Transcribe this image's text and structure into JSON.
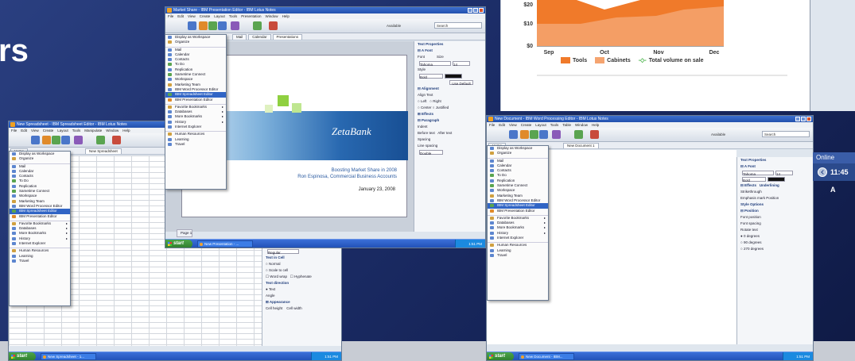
{
  "slide": {
    "title_fragment": "rs"
  },
  "chart": {
    "y_ticks": [
      "$20",
      "$10",
      "$0"
    ],
    "x_ticks": [
      "Sep",
      "Oct",
      "Nov",
      "Dec"
    ],
    "legend": [
      "Tools",
      "Cabinets",
      "Total volume on sale"
    ],
    "colors": {
      "tools": "#f08030",
      "cabinets": "#f6a878",
      "total": "#33aa33"
    }
  },
  "presentation_window": {
    "title": "Market Share - IBM Presentation Editor - IBM Lotus Notes",
    "menu": [
      "File",
      "Edit",
      "View",
      "Create",
      "Layout",
      "Tools",
      "Presentation",
      "Window",
      "Help"
    ],
    "available": "Available",
    "search": "Search",
    "tabs": [
      "Home",
      "Mail",
      "Calendar",
      "Presentations"
    ],
    "slide_brand": "ZetaBank",
    "slide_heading": "Boosting Market Share in 2008",
    "slide_sub": "Ron Espinosa, Commercial Business Accounts",
    "slide_date": "January 23, 2008",
    "panel": {
      "title": "Text Properties",
      "font": "Font",
      "font_label": "Font",
      "size_label": "Size",
      "font_value": "Tahoma",
      "size_value": "14",
      "style_label": "Style",
      "style_value": "Bold",
      "font_color": "Font color",
      "use_default": "Use Default",
      "alignment": "Alignment",
      "align_text": "Align Text",
      "left": "Left",
      "right": "Right",
      "center": "Center",
      "justified": "Justified",
      "effects": "Effects",
      "paragraph": "Paragraph",
      "indent": "Indent",
      "before_text": "Before text",
      "after_text": "After text",
      "spacing": "Spacing",
      "line_spacing": "Line spacing",
      "line_spacing_value": "Double"
    },
    "page_label": "Page 1",
    "taskbar_start": "start",
    "taskbar_item": "New Presentation - ...",
    "clock": "1:51 PM"
  },
  "spreadsheet_window": {
    "title": "New Spreadsheet - IBM Spreadsheet Editor - IBM Lotus Notes",
    "menu": [
      "File",
      "Edit",
      "View",
      "Create",
      "Layout",
      "Tools",
      "Manipulate",
      "Window",
      "Help"
    ],
    "tabs": [
      "Home",
      "New Spreadsheet"
    ],
    "panel": {
      "regular": "Regular",
      "text_in_cell": "Text in Cell",
      "normal": "Normal",
      "scale_to_cell": "Scale to cell",
      "word_wrap": "Word wrap",
      "hyphenate": "Hyphenate",
      "text_direction": "Text direction",
      "text": "Text",
      "angle": "Angle",
      "appearance": "Appearance",
      "cell_height": "Cell height",
      "cell_width": "Cell width"
    },
    "taskbar_start": "start",
    "taskbar_item": "New Spreadsheet - 1...",
    "clock": "1:51 PM",
    "status": "Online"
  },
  "document_window": {
    "title": "New Document - IBM Word Processing Editor - IBM Lotus Notes",
    "menu": [
      "File",
      "Edit",
      "View",
      "Create",
      "Layout",
      "Tools",
      "Table",
      "Window",
      "Help"
    ],
    "available": "Available",
    "search": "Search",
    "tabs": [
      "Home",
      "New Document 1"
    ],
    "panel": {
      "title": "Text Properties",
      "font": "Font",
      "font_value": "Tahoma",
      "size_value": "14",
      "style_value": "Bold",
      "effects": "Effects",
      "underlining": "Underlining",
      "strikethrough": "Strikethrough",
      "emphasis": "Emphasis mark",
      "position": "Position",
      "style_options": "Style Options",
      "position_head": "Position",
      "font_position": "Font position",
      "font_spacing": "Font spacing",
      "rotate_text": "Rotate text",
      "deg0": "0 degrees",
      "deg90": "90 degrees",
      "deg270": "270 degrees"
    },
    "taskbar_start": "start",
    "taskbar_item": "New Document - IBM...",
    "clock": "1:51 PM",
    "status": "Online"
  },
  "launcher_menu": {
    "items": [
      "Display as Workspace",
      "Organize",
      "",
      "Mail",
      "Calendar",
      "Contacts",
      "To Do",
      "Replication",
      "Sametime Connect",
      "Workspace",
      "Marketing Team",
      "IBM Word Processor Editor",
      "IBM Spreadsheet Editor",
      "IBM Presentation Editor",
      "",
      "Favorite Bookmarks",
      "Databases",
      "More Bookmarks",
      "History",
      "Internet Explorer",
      "",
      "Human Resources",
      "Learning",
      "Travel"
    ]
  },
  "right_edge": {
    "online": "Online",
    "clock": "11:45 A"
  }
}
